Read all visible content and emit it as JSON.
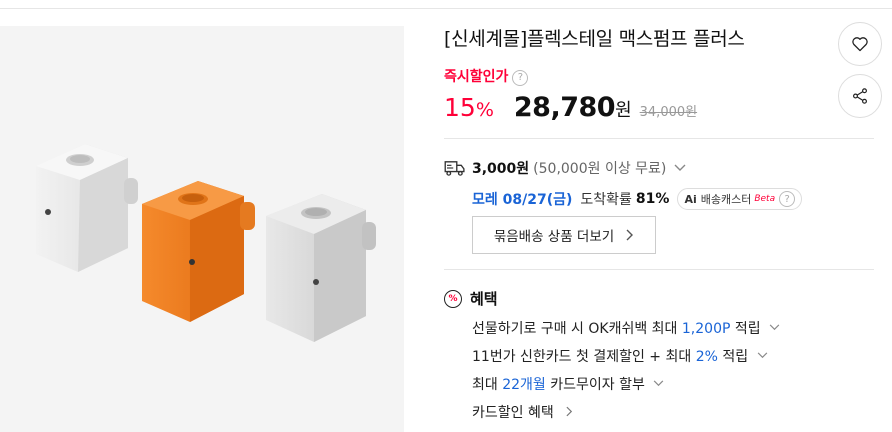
{
  "product": {
    "title": "[신세계몰]플렉스테일 맥스펌프 플러스",
    "discount_label": "즉시할인가",
    "discount_rate": "15",
    "discount_rate_unit": "%",
    "price": "28,780",
    "price_unit": "원",
    "original_price": "34,000원"
  },
  "shipping": {
    "fee": "3,000원",
    "condition": "(50,000원 이상 무료)",
    "arrival_date": "모레 08/27(금)",
    "arrival_prob_label": "도착확률",
    "arrival_prob": "81%",
    "ai_badge_ai": "Ai",
    "ai_badge_label": "배송캐스터",
    "ai_badge_beta": "Beta",
    "bundle_button": "묶음배송 상품 더보기"
  },
  "benefits": {
    "title": "혜택",
    "row1_pre": "선물하기로 구매 시 OK캐쉬백 최대 ",
    "row1_hl": "1,200P",
    "row1_post": " 적립",
    "row2_pre": "11번가 신한카드 첫 결제할인 + 최대 ",
    "row2_hl": "2%",
    "row2_post": " 적립",
    "row3_pre": "최대 ",
    "row3_hl": "22개월",
    "row3_post": " 카드무이자 할부",
    "row4": "카드할인 혜택"
  },
  "help_glyph": "?",
  "percent_glyph": "%",
  "colors": {
    "accent_red": "#ff0038",
    "link_blue": "#1a64d6",
    "pump_orange": "#f07a1c"
  },
  "icons": [
    "heart-icon",
    "share-icon",
    "truck-icon",
    "help-icon",
    "percent-icon",
    "chevron-down-icon",
    "chevron-right-icon"
  ]
}
